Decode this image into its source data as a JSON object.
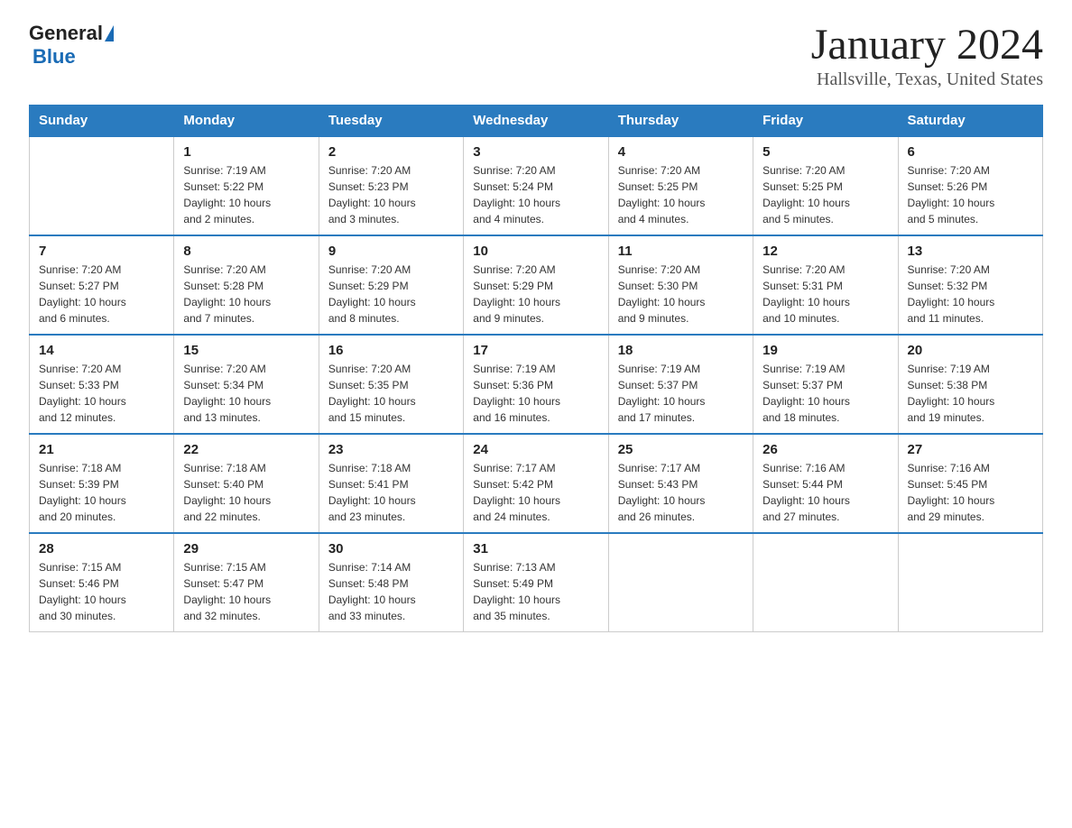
{
  "header": {
    "logo_general": "General",
    "logo_blue": "Blue",
    "title": "January 2024",
    "subtitle": "Hallsville, Texas, United States"
  },
  "calendar": {
    "days_of_week": [
      "Sunday",
      "Monday",
      "Tuesday",
      "Wednesday",
      "Thursday",
      "Friday",
      "Saturday"
    ],
    "weeks": [
      [
        {
          "num": "",
          "info": ""
        },
        {
          "num": "1",
          "info": "Sunrise: 7:19 AM\nSunset: 5:22 PM\nDaylight: 10 hours\nand 2 minutes."
        },
        {
          "num": "2",
          "info": "Sunrise: 7:20 AM\nSunset: 5:23 PM\nDaylight: 10 hours\nand 3 minutes."
        },
        {
          "num": "3",
          "info": "Sunrise: 7:20 AM\nSunset: 5:24 PM\nDaylight: 10 hours\nand 4 minutes."
        },
        {
          "num": "4",
          "info": "Sunrise: 7:20 AM\nSunset: 5:25 PM\nDaylight: 10 hours\nand 4 minutes."
        },
        {
          "num": "5",
          "info": "Sunrise: 7:20 AM\nSunset: 5:25 PM\nDaylight: 10 hours\nand 5 minutes."
        },
        {
          "num": "6",
          "info": "Sunrise: 7:20 AM\nSunset: 5:26 PM\nDaylight: 10 hours\nand 5 minutes."
        }
      ],
      [
        {
          "num": "7",
          "info": "Sunrise: 7:20 AM\nSunset: 5:27 PM\nDaylight: 10 hours\nand 6 minutes."
        },
        {
          "num": "8",
          "info": "Sunrise: 7:20 AM\nSunset: 5:28 PM\nDaylight: 10 hours\nand 7 minutes."
        },
        {
          "num": "9",
          "info": "Sunrise: 7:20 AM\nSunset: 5:29 PM\nDaylight: 10 hours\nand 8 minutes."
        },
        {
          "num": "10",
          "info": "Sunrise: 7:20 AM\nSunset: 5:29 PM\nDaylight: 10 hours\nand 9 minutes."
        },
        {
          "num": "11",
          "info": "Sunrise: 7:20 AM\nSunset: 5:30 PM\nDaylight: 10 hours\nand 9 minutes."
        },
        {
          "num": "12",
          "info": "Sunrise: 7:20 AM\nSunset: 5:31 PM\nDaylight: 10 hours\nand 10 minutes."
        },
        {
          "num": "13",
          "info": "Sunrise: 7:20 AM\nSunset: 5:32 PM\nDaylight: 10 hours\nand 11 minutes."
        }
      ],
      [
        {
          "num": "14",
          "info": "Sunrise: 7:20 AM\nSunset: 5:33 PM\nDaylight: 10 hours\nand 12 minutes."
        },
        {
          "num": "15",
          "info": "Sunrise: 7:20 AM\nSunset: 5:34 PM\nDaylight: 10 hours\nand 13 minutes."
        },
        {
          "num": "16",
          "info": "Sunrise: 7:20 AM\nSunset: 5:35 PM\nDaylight: 10 hours\nand 15 minutes."
        },
        {
          "num": "17",
          "info": "Sunrise: 7:19 AM\nSunset: 5:36 PM\nDaylight: 10 hours\nand 16 minutes."
        },
        {
          "num": "18",
          "info": "Sunrise: 7:19 AM\nSunset: 5:37 PM\nDaylight: 10 hours\nand 17 minutes."
        },
        {
          "num": "19",
          "info": "Sunrise: 7:19 AM\nSunset: 5:37 PM\nDaylight: 10 hours\nand 18 minutes."
        },
        {
          "num": "20",
          "info": "Sunrise: 7:19 AM\nSunset: 5:38 PM\nDaylight: 10 hours\nand 19 minutes."
        }
      ],
      [
        {
          "num": "21",
          "info": "Sunrise: 7:18 AM\nSunset: 5:39 PM\nDaylight: 10 hours\nand 20 minutes."
        },
        {
          "num": "22",
          "info": "Sunrise: 7:18 AM\nSunset: 5:40 PM\nDaylight: 10 hours\nand 22 minutes."
        },
        {
          "num": "23",
          "info": "Sunrise: 7:18 AM\nSunset: 5:41 PM\nDaylight: 10 hours\nand 23 minutes."
        },
        {
          "num": "24",
          "info": "Sunrise: 7:17 AM\nSunset: 5:42 PM\nDaylight: 10 hours\nand 24 minutes."
        },
        {
          "num": "25",
          "info": "Sunrise: 7:17 AM\nSunset: 5:43 PM\nDaylight: 10 hours\nand 26 minutes."
        },
        {
          "num": "26",
          "info": "Sunrise: 7:16 AM\nSunset: 5:44 PM\nDaylight: 10 hours\nand 27 minutes."
        },
        {
          "num": "27",
          "info": "Sunrise: 7:16 AM\nSunset: 5:45 PM\nDaylight: 10 hours\nand 29 minutes."
        }
      ],
      [
        {
          "num": "28",
          "info": "Sunrise: 7:15 AM\nSunset: 5:46 PM\nDaylight: 10 hours\nand 30 minutes."
        },
        {
          "num": "29",
          "info": "Sunrise: 7:15 AM\nSunset: 5:47 PM\nDaylight: 10 hours\nand 32 minutes."
        },
        {
          "num": "30",
          "info": "Sunrise: 7:14 AM\nSunset: 5:48 PM\nDaylight: 10 hours\nand 33 minutes."
        },
        {
          "num": "31",
          "info": "Sunrise: 7:13 AM\nSunset: 5:49 PM\nDaylight: 10 hours\nand 35 minutes."
        },
        {
          "num": "",
          "info": ""
        },
        {
          "num": "",
          "info": ""
        },
        {
          "num": "",
          "info": ""
        }
      ]
    ]
  }
}
